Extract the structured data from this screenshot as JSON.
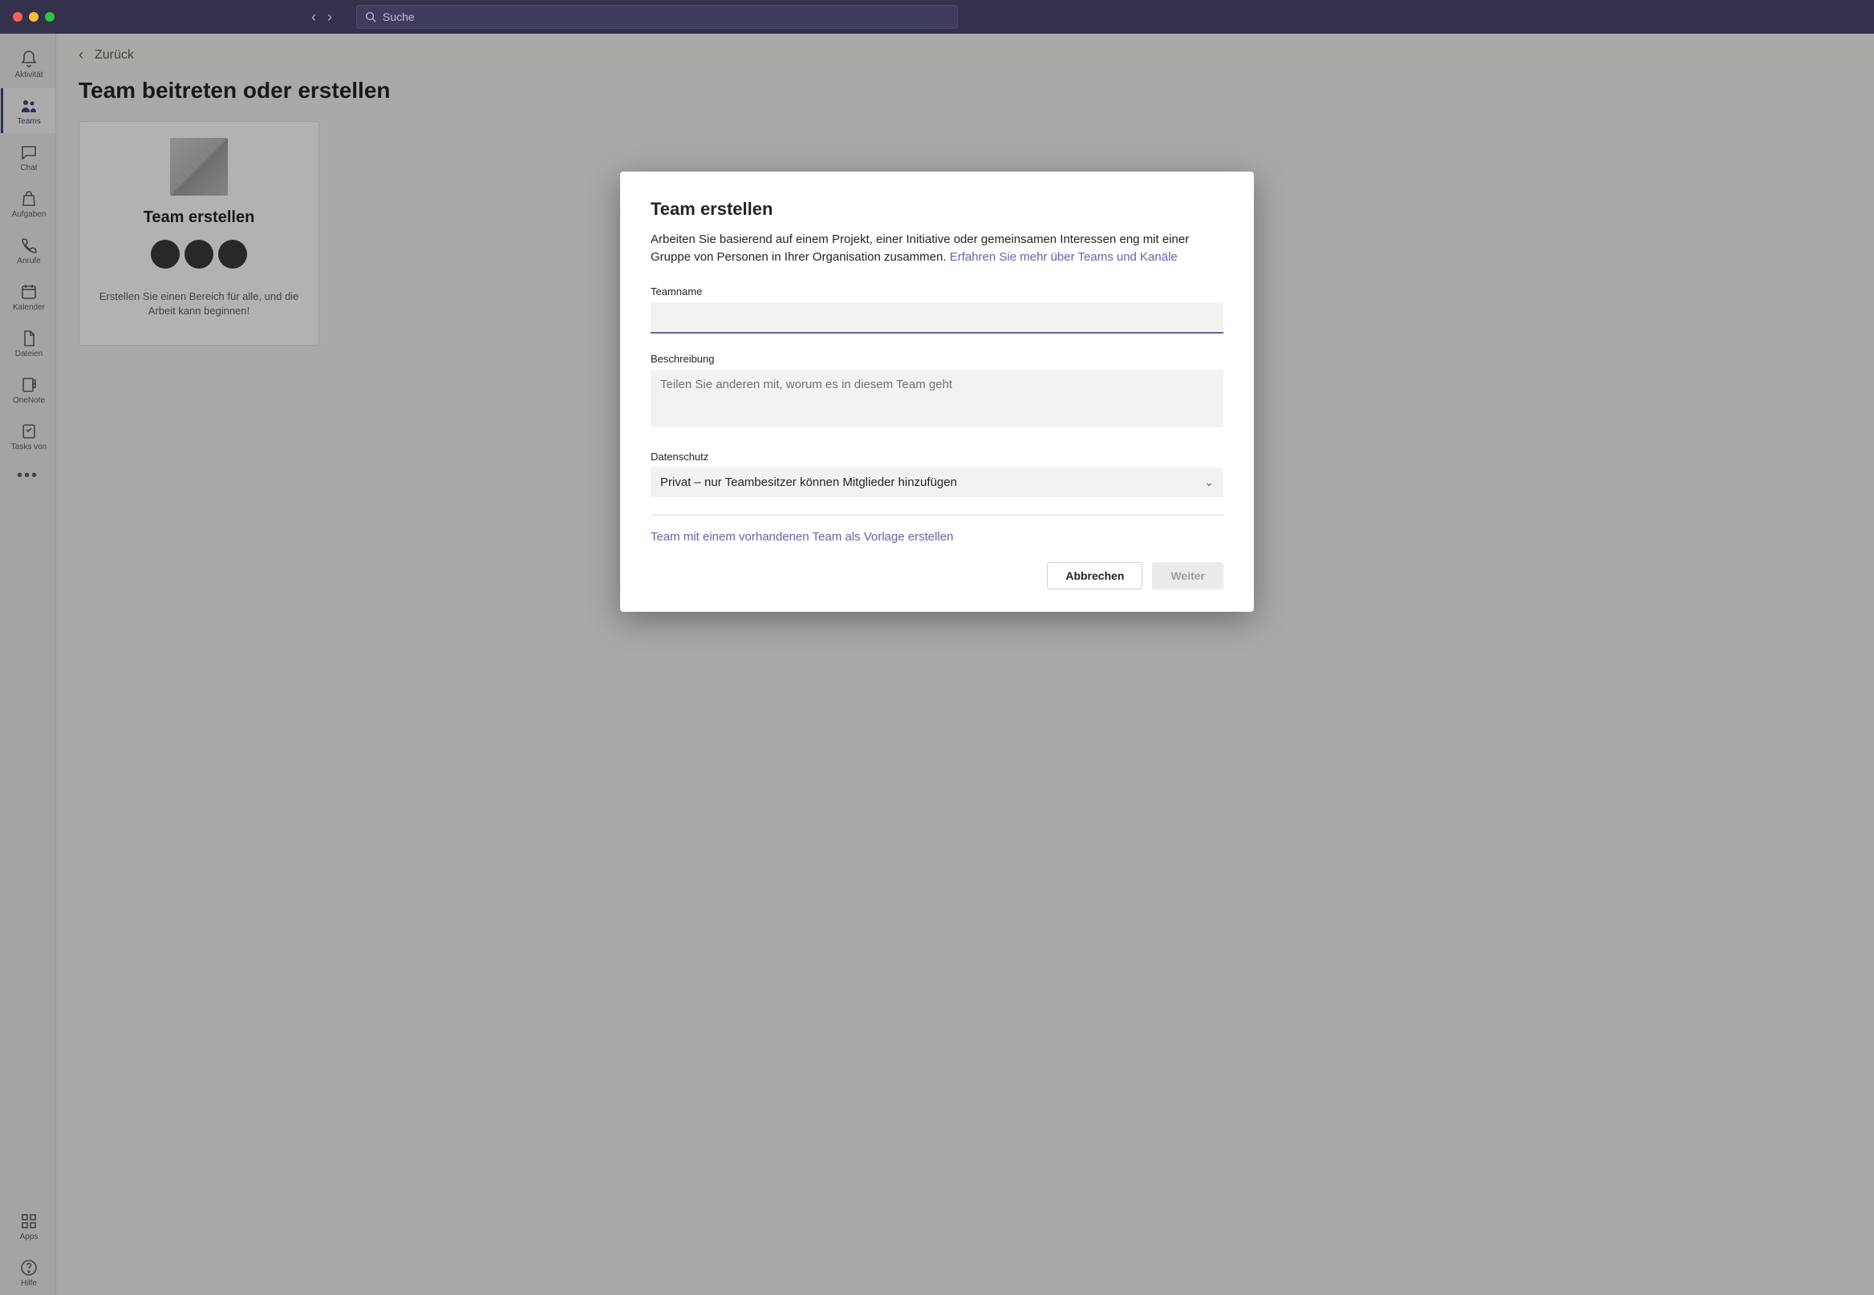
{
  "titlebar": {
    "search_placeholder": "Suche"
  },
  "rail": {
    "items": [
      {
        "label": "Aktivität"
      },
      {
        "label": "Teams"
      },
      {
        "label": "Chat"
      },
      {
        "label": "Aufgaben"
      },
      {
        "label": "Anrufe"
      },
      {
        "label": "Kalender"
      },
      {
        "label": "Dateien"
      },
      {
        "label": "OneNote"
      },
      {
        "label": "Tasks von"
      }
    ],
    "apps": "Apps",
    "help": "Hilfe"
  },
  "content": {
    "back": "Zurück",
    "page_title": "Team beitreten oder erstellen",
    "tile_create_title": "Team erstellen",
    "tile_create_sub": "Erstellen Sie einen Bereich für alle, und die Arbeit kann beginnen!"
  },
  "modal": {
    "title": "Team erstellen",
    "intro_text": "Arbeiten Sie basierend auf einem Projekt, einer Initiative oder gemeinsamen Interessen eng mit einer Gruppe von Personen in Ihrer Organisation zusammen. ",
    "intro_link": "Erfahren Sie mehr über Teams und Kanäle",
    "label_name": "Teamname",
    "name_value": "",
    "label_desc": "Beschreibung",
    "desc_placeholder": "Teilen Sie anderen mit, worum es in diesem Team geht",
    "label_privacy": "Datenschutz",
    "privacy_value": "Privat – nur Teambesitzer können Mitglieder hinzufügen",
    "template_link": "Team mit einem vorhandenen Team als Vorlage erstellen",
    "cancel": "Abbrechen",
    "next": "Weiter"
  }
}
